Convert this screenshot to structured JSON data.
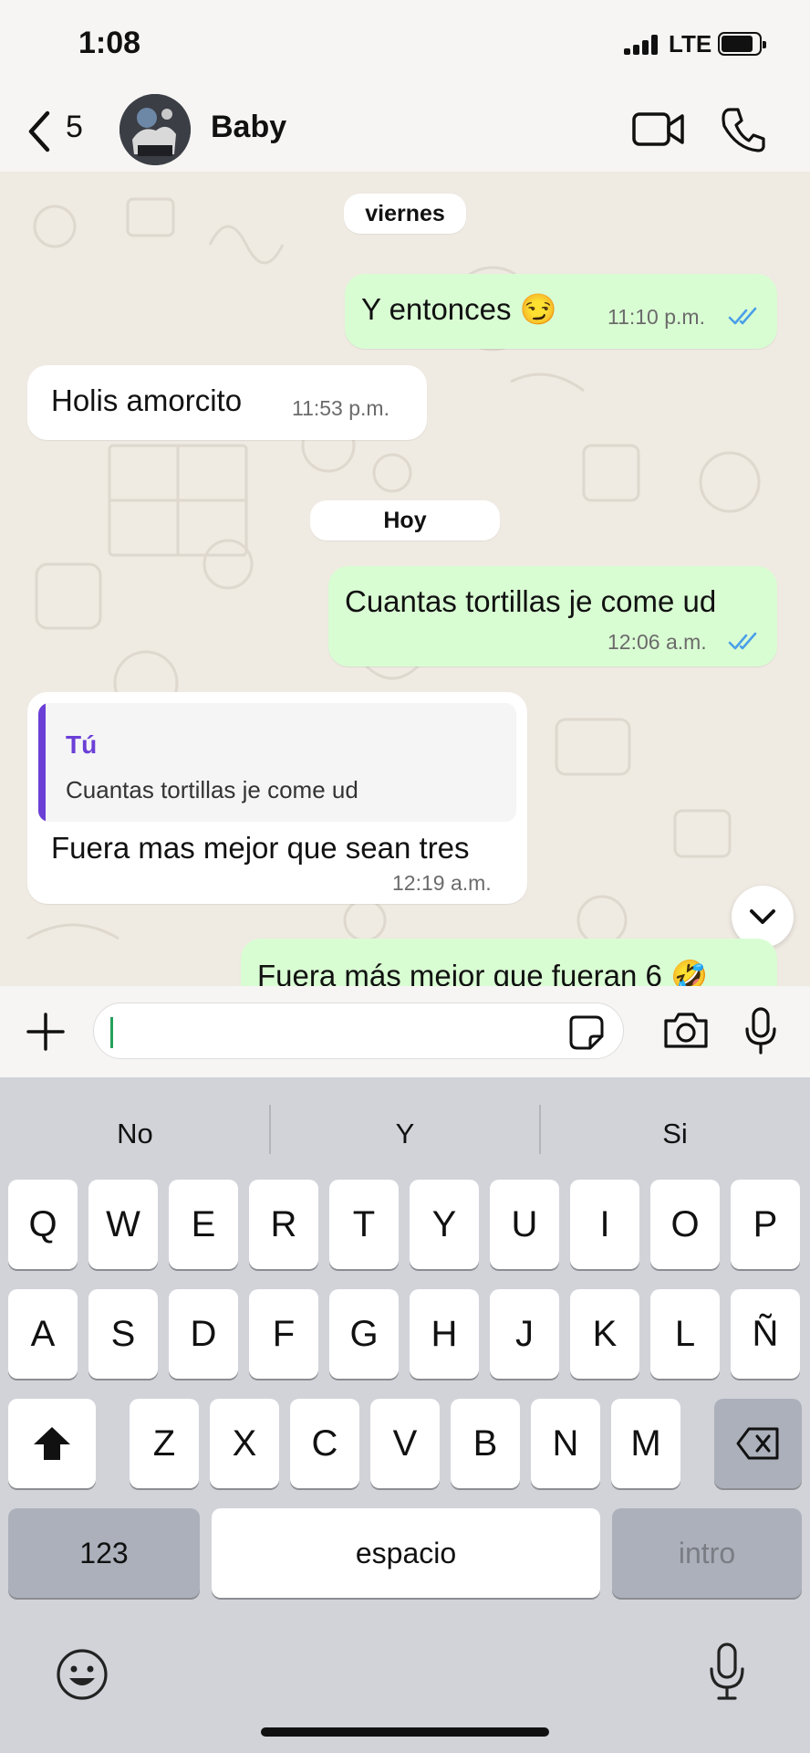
{
  "status_bar": {
    "time": "1:08",
    "network": "LTE"
  },
  "header": {
    "back_count": "5",
    "contact_name": "Baby"
  },
  "chat": {
    "day_labels": {
      "previous": "viernes",
      "today": "Hoy"
    },
    "messages": [
      {
        "direction": "outgoing",
        "text": "Y entonces 😏",
        "time": "11:10 p.m.",
        "read": true
      },
      {
        "direction": "incoming",
        "text": "Holis amorcito",
        "time": "11:53 p.m."
      },
      {
        "direction": "outgoing",
        "text": "Cuantas tortillas je come ud",
        "time": "12:06 a.m.",
        "read": true
      },
      {
        "direction": "incoming",
        "text": "Fuera mas mejor que sean tres",
        "time": "12:19 a.m.",
        "reply": {
          "author": "Tú",
          "text": "Cuantas tortillas je come ud"
        }
      },
      {
        "direction": "outgoing",
        "text": "Fuera más mejor que fueran 6 🤣"
      }
    ]
  },
  "input": {
    "value": "",
    "placeholder": ""
  },
  "keyboard": {
    "suggestions": [
      "No",
      "Y",
      "Si"
    ],
    "row1": [
      "Q",
      "W",
      "E",
      "R",
      "T",
      "Y",
      "U",
      "I",
      "O",
      "P"
    ],
    "row2": [
      "A",
      "S",
      "D",
      "F",
      "G",
      "H",
      "J",
      "K",
      "L",
      "Ñ"
    ],
    "row3": [
      "Z",
      "X",
      "C",
      "V",
      "B",
      "N",
      "M"
    ],
    "numbers_key": "123",
    "space_key": "espacio",
    "return_key": "intro"
  },
  "colors": {
    "outgoing_bubble": "#d9fdd3",
    "incoming_bubble": "#ffffff",
    "read_ticks": "#4a9fe8",
    "quote_accent": "#6b3fd6",
    "chat_background": "#efeae2"
  },
  "icons": [
    "back-chevron-icon",
    "video-call-icon",
    "phone-icon",
    "read-receipts-icon",
    "chevron-down-icon",
    "plus-icon",
    "sticker-icon",
    "camera-icon",
    "microphone-icon",
    "shift-icon",
    "backspace-icon",
    "emoji-icon"
  ]
}
